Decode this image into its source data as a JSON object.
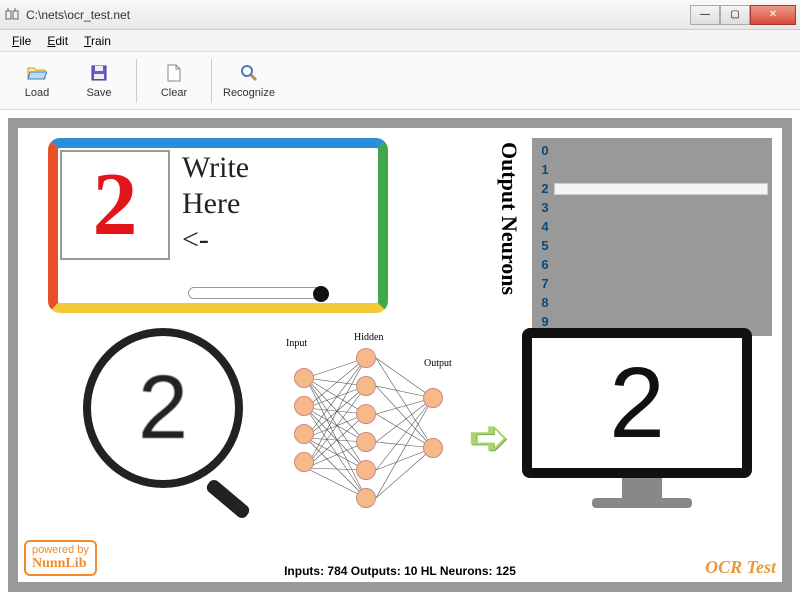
{
  "window": {
    "title": "C:\\nets\\ocr_test.net"
  },
  "menu": {
    "file": "File",
    "edit": "Edit",
    "train": "Train"
  },
  "toolbar": {
    "load": "Load",
    "save": "Save",
    "clear": "Clear",
    "recognize": "Recognize"
  },
  "whiteboard": {
    "drawn_digit": "2",
    "hint_line1": "Write",
    "hint_line2": "Here",
    "hint_line3": "<-"
  },
  "output_neurons": {
    "label": "Output Neurons",
    "rows": [
      {
        "idx": "0",
        "pct": 0
      },
      {
        "idx": "1",
        "pct": 0
      },
      {
        "idx": "2",
        "pct": 100
      },
      {
        "idx": "3",
        "pct": 0
      },
      {
        "idx": "4",
        "pct": 0
      },
      {
        "idx": "5",
        "pct": 0
      },
      {
        "idx": "6",
        "pct": 0
      },
      {
        "idx": "7",
        "pct": 0
      },
      {
        "idx": "8",
        "pct": 0
      },
      {
        "idx": "9",
        "pct": 0
      }
    ]
  },
  "magnifier": {
    "digit": "2"
  },
  "nn": {
    "input_label": "Input",
    "hidden_label": "Hidden",
    "output_label": "Output"
  },
  "monitor": {
    "digit": "2"
  },
  "badge": {
    "line1": "powered by",
    "line2": "NunnLib"
  },
  "stats": {
    "text": "Inputs: 784   Outputs: 10   HL Neurons: 125",
    "inputs": 784,
    "outputs": 10,
    "hl_neurons": 125
  },
  "brand": "OCR Test"
}
